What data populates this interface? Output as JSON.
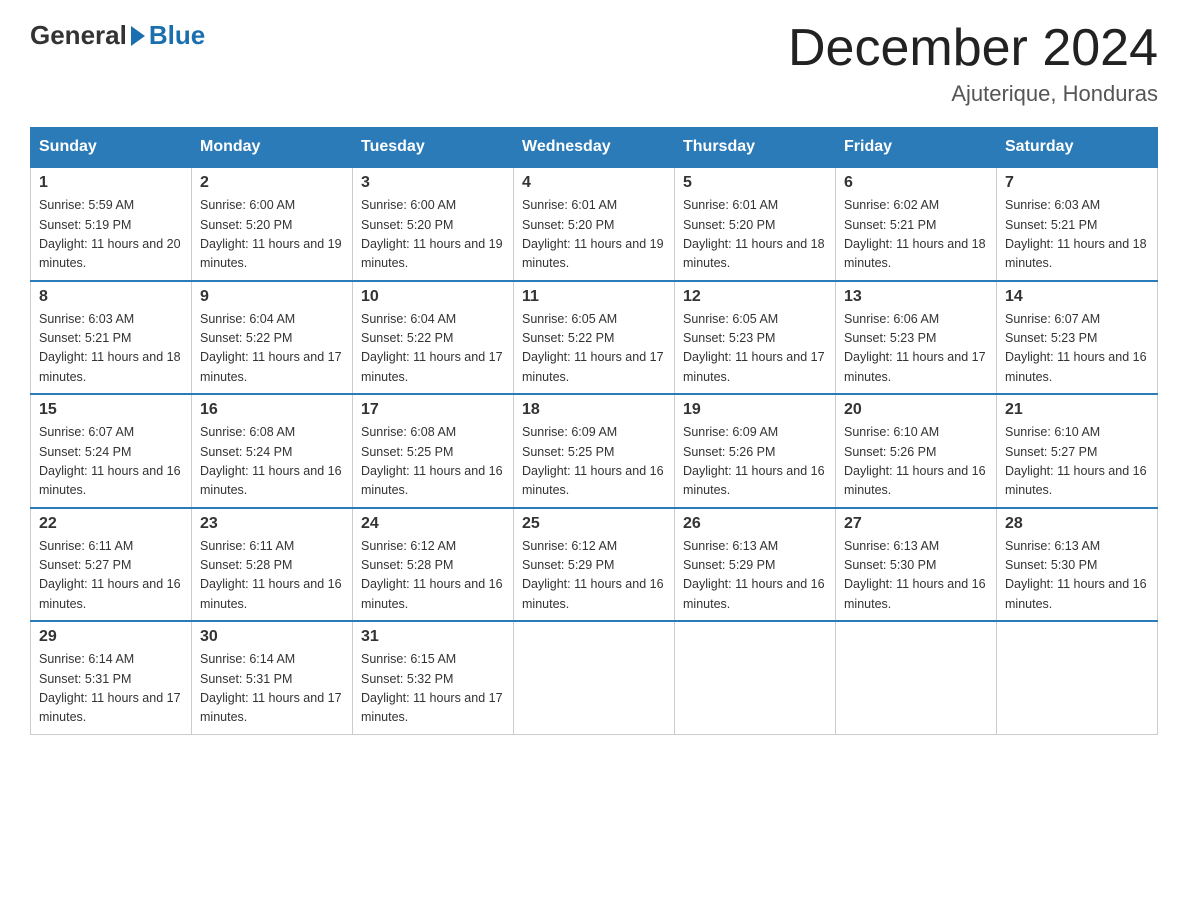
{
  "header": {
    "logo_general": "General",
    "logo_blue": "Blue",
    "month_title": "December 2024",
    "location": "Ajuterique, Honduras"
  },
  "weekdays": [
    "Sunday",
    "Monday",
    "Tuesday",
    "Wednesday",
    "Thursday",
    "Friday",
    "Saturday"
  ],
  "weeks": [
    [
      {
        "day": "1",
        "sunrise": "5:59 AM",
        "sunset": "5:19 PM",
        "daylight": "11 hours and 20 minutes."
      },
      {
        "day": "2",
        "sunrise": "6:00 AM",
        "sunset": "5:20 PM",
        "daylight": "11 hours and 19 minutes."
      },
      {
        "day": "3",
        "sunrise": "6:00 AM",
        "sunset": "5:20 PM",
        "daylight": "11 hours and 19 minutes."
      },
      {
        "day": "4",
        "sunrise": "6:01 AM",
        "sunset": "5:20 PM",
        "daylight": "11 hours and 19 minutes."
      },
      {
        "day": "5",
        "sunrise": "6:01 AM",
        "sunset": "5:20 PM",
        "daylight": "11 hours and 18 minutes."
      },
      {
        "day": "6",
        "sunrise": "6:02 AM",
        "sunset": "5:21 PM",
        "daylight": "11 hours and 18 minutes."
      },
      {
        "day": "7",
        "sunrise": "6:03 AM",
        "sunset": "5:21 PM",
        "daylight": "11 hours and 18 minutes."
      }
    ],
    [
      {
        "day": "8",
        "sunrise": "6:03 AM",
        "sunset": "5:21 PM",
        "daylight": "11 hours and 18 minutes."
      },
      {
        "day": "9",
        "sunrise": "6:04 AM",
        "sunset": "5:22 PM",
        "daylight": "11 hours and 17 minutes."
      },
      {
        "day": "10",
        "sunrise": "6:04 AM",
        "sunset": "5:22 PM",
        "daylight": "11 hours and 17 minutes."
      },
      {
        "day": "11",
        "sunrise": "6:05 AM",
        "sunset": "5:22 PM",
        "daylight": "11 hours and 17 minutes."
      },
      {
        "day": "12",
        "sunrise": "6:05 AM",
        "sunset": "5:23 PM",
        "daylight": "11 hours and 17 minutes."
      },
      {
        "day": "13",
        "sunrise": "6:06 AM",
        "sunset": "5:23 PM",
        "daylight": "11 hours and 17 minutes."
      },
      {
        "day": "14",
        "sunrise": "6:07 AM",
        "sunset": "5:23 PM",
        "daylight": "11 hours and 16 minutes."
      }
    ],
    [
      {
        "day": "15",
        "sunrise": "6:07 AM",
        "sunset": "5:24 PM",
        "daylight": "11 hours and 16 minutes."
      },
      {
        "day": "16",
        "sunrise": "6:08 AM",
        "sunset": "5:24 PM",
        "daylight": "11 hours and 16 minutes."
      },
      {
        "day": "17",
        "sunrise": "6:08 AM",
        "sunset": "5:25 PM",
        "daylight": "11 hours and 16 minutes."
      },
      {
        "day": "18",
        "sunrise": "6:09 AM",
        "sunset": "5:25 PM",
        "daylight": "11 hours and 16 minutes."
      },
      {
        "day": "19",
        "sunrise": "6:09 AM",
        "sunset": "5:26 PM",
        "daylight": "11 hours and 16 minutes."
      },
      {
        "day": "20",
        "sunrise": "6:10 AM",
        "sunset": "5:26 PM",
        "daylight": "11 hours and 16 minutes."
      },
      {
        "day": "21",
        "sunrise": "6:10 AM",
        "sunset": "5:27 PM",
        "daylight": "11 hours and 16 minutes."
      }
    ],
    [
      {
        "day": "22",
        "sunrise": "6:11 AM",
        "sunset": "5:27 PM",
        "daylight": "11 hours and 16 minutes."
      },
      {
        "day": "23",
        "sunrise": "6:11 AM",
        "sunset": "5:28 PM",
        "daylight": "11 hours and 16 minutes."
      },
      {
        "day": "24",
        "sunrise": "6:12 AM",
        "sunset": "5:28 PM",
        "daylight": "11 hours and 16 minutes."
      },
      {
        "day": "25",
        "sunrise": "6:12 AM",
        "sunset": "5:29 PM",
        "daylight": "11 hours and 16 minutes."
      },
      {
        "day": "26",
        "sunrise": "6:13 AM",
        "sunset": "5:29 PM",
        "daylight": "11 hours and 16 minutes."
      },
      {
        "day": "27",
        "sunrise": "6:13 AM",
        "sunset": "5:30 PM",
        "daylight": "11 hours and 16 minutes."
      },
      {
        "day": "28",
        "sunrise": "6:13 AM",
        "sunset": "5:30 PM",
        "daylight": "11 hours and 16 minutes."
      }
    ],
    [
      {
        "day": "29",
        "sunrise": "6:14 AM",
        "sunset": "5:31 PM",
        "daylight": "11 hours and 17 minutes."
      },
      {
        "day": "30",
        "sunrise": "6:14 AM",
        "sunset": "5:31 PM",
        "daylight": "11 hours and 17 minutes."
      },
      {
        "day": "31",
        "sunrise": "6:15 AM",
        "sunset": "5:32 PM",
        "daylight": "11 hours and 17 minutes."
      },
      null,
      null,
      null,
      null
    ]
  ]
}
